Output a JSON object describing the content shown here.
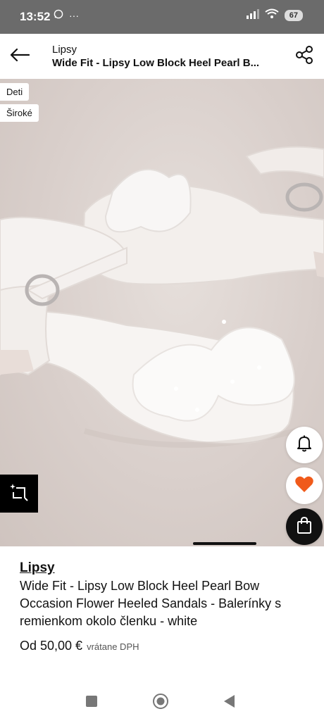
{
  "status_bar": {
    "time": "13:52",
    "dots": "···",
    "battery": "67",
    "icons": [
      "whatsapp-icon",
      "signal-icon",
      "wifi-icon",
      "battery-icon"
    ]
  },
  "header": {
    "brand": "Lipsy",
    "title": "Wide Fit - Lipsy Low Block Heel Pearl B...",
    "icons": [
      "back-arrow-icon",
      "share-icon"
    ]
  },
  "image": {
    "tags": [
      "Deti",
      "Široké"
    ],
    "icons": [
      "bell-icon",
      "heart-icon",
      "shopping-bag-icon",
      "ai-crop-icon"
    ],
    "colors": {
      "heart": "#f05a1a",
      "background": "#d9cfcb"
    }
  },
  "product": {
    "brand": "Lipsy",
    "name": "Wide Fit - Lipsy Low Block Heel Pearl Bow Occasion Flower Heeled Sandals - Balerínky s remienkom okolo členku - white",
    "price": "Od 50,00 €",
    "vat_note": "vrátane DPH"
  },
  "nav": {
    "icons": [
      "recents-square-icon",
      "home-circle-icon",
      "back-triangle-icon"
    ]
  }
}
